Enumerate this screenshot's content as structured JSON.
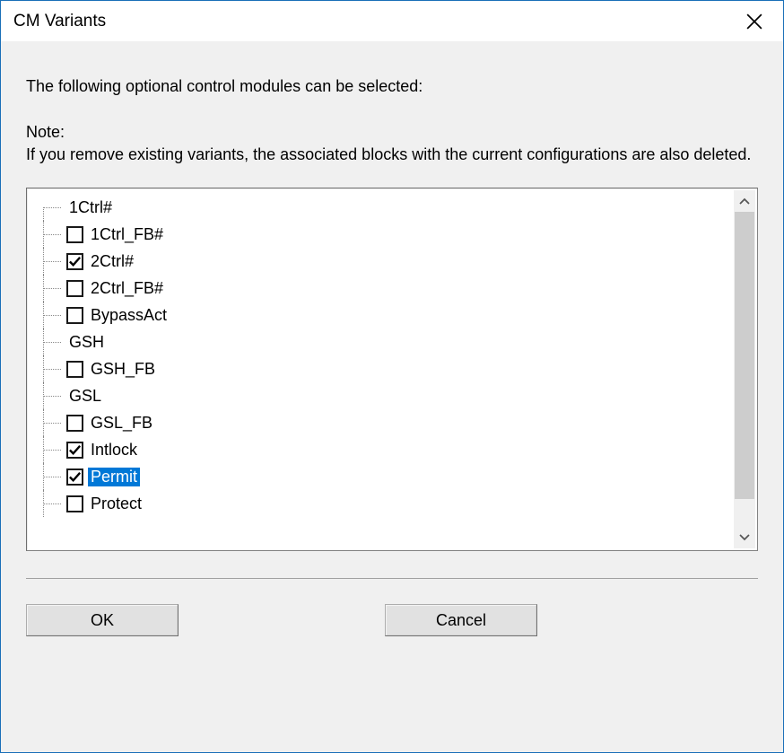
{
  "dialog": {
    "title": "CM Variants",
    "intro": "The following optional control modules can be selected:",
    "note_label": "Note:",
    "note_text": "If you remove existing variants, the associated blocks with the current configurations are also deleted.",
    "buttons": {
      "ok": "OK",
      "cancel": "Cancel"
    }
  },
  "tree": {
    "items": [
      {
        "label": "1Ctrl#",
        "has_checkbox": false,
        "checked": false,
        "selected": false
      },
      {
        "label": "1Ctrl_FB#",
        "has_checkbox": true,
        "checked": false,
        "selected": false
      },
      {
        "label": "2Ctrl#",
        "has_checkbox": true,
        "checked": true,
        "selected": false
      },
      {
        "label": "2Ctrl_FB#",
        "has_checkbox": true,
        "checked": false,
        "selected": false
      },
      {
        "label": "BypassAct",
        "has_checkbox": true,
        "checked": false,
        "selected": false
      },
      {
        "label": "GSH",
        "has_checkbox": false,
        "checked": false,
        "selected": false
      },
      {
        "label": "GSH_FB",
        "has_checkbox": true,
        "checked": false,
        "selected": false
      },
      {
        "label": "GSL",
        "has_checkbox": false,
        "checked": false,
        "selected": false
      },
      {
        "label": "GSL_FB",
        "has_checkbox": true,
        "checked": false,
        "selected": false
      },
      {
        "label": "Intlock",
        "has_checkbox": true,
        "checked": true,
        "selected": false
      },
      {
        "label": "Permit",
        "has_checkbox": true,
        "checked": true,
        "selected": true
      },
      {
        "label": "Protect",
        "has_checkbox": true,
        "checked": false,
        "selected": false
      }
    ]
  }
}
